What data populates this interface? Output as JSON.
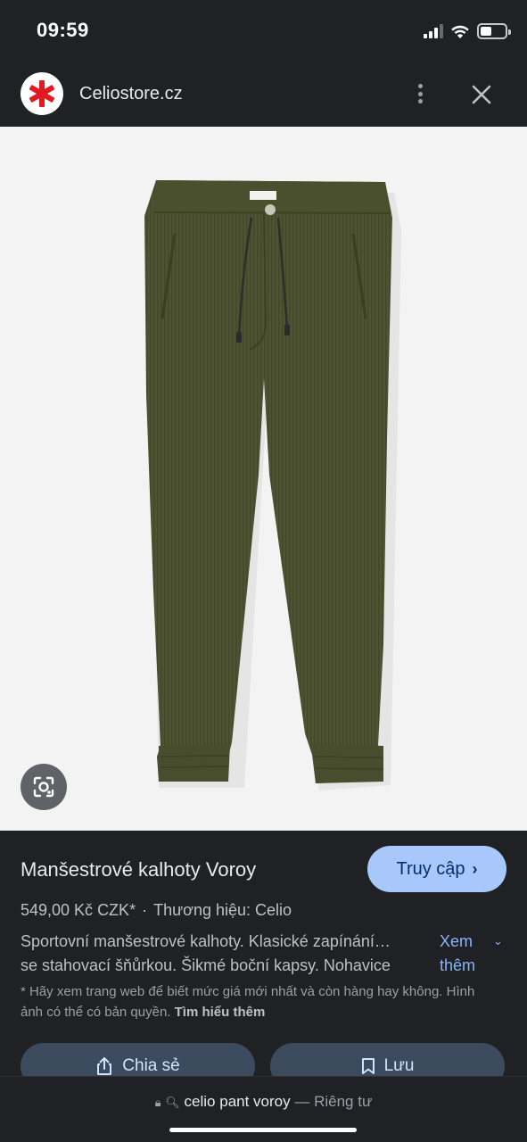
{
  "status_bar": {
    "time": "09:59"
  },
  "header": {
    "site_name": "Celiostore.cz",
    "logo_color": "#e11a22"
  },
  "product": {
    "title": "Manšestrové kalhoty Voroy",
    "visit_label": "Truy cập",
    "price": "549,00 Kč CZK*",
    "separator": "·",
    "brand": "Thương hiệu: Celio",
    "description_line1": "Sportovní manšestrové kalhoty. Klasické zapínání…",
    "description_line2": "se stahovací šňůrkou. Šikmé boční kapsy. Nohavice",
    "more_label": "Xem thêm",
    "disclaimer_text": "* Hãy xem trang web để biết mức giá mới nhất và còn hàng hay không. Hình ảnh có thể có bản quyền.",
    "learn_more": "Tìm hiểu thêm",
    "image_color": "#4e5331"
  },
  "actions": {
    "share_label": "Chia sẻ",
    "save_label": "Lưu"
  },
  "address_bar": {
    "query": "celio pant voroy",
    "dash": "—",
    "privacy": "Riêng tư"
  }
}
